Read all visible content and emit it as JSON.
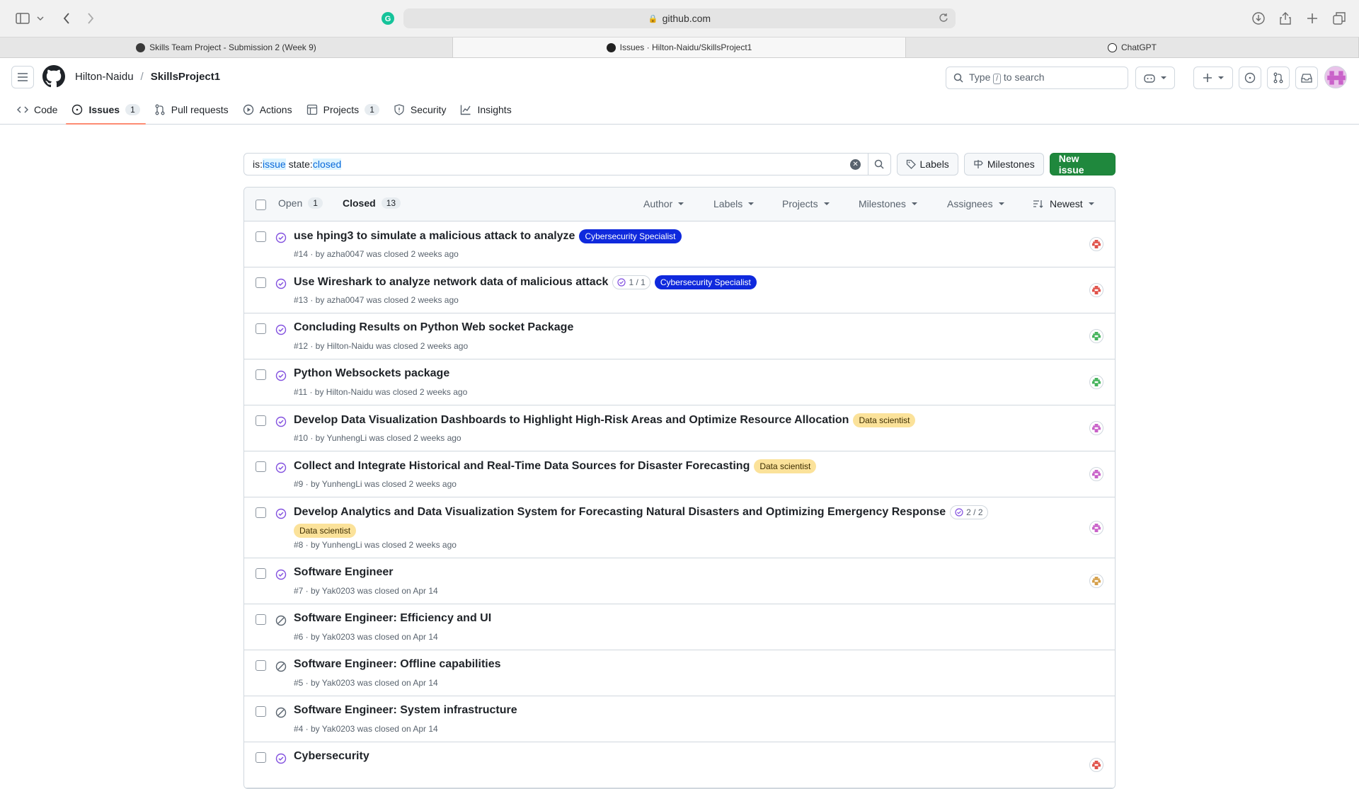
{
  "browser": {
    "address": "github.com",
    "tabs": [
      {
        "label": "Skills Team Project - Submission 2 (Week 9)",
        "active": false
      },
      {
        "label": "Issues · Hilton-Naidu/SkillsProject1",
        "active": true
      },
      {
        "label": "ChatGPT",
        "active": false
      }
    ]
  },
  "header": {
    "owner": "Hilton-Naidu",
    "separator": "/",
    "repo": "SkillsProject1",
    "search_prefix": "Type",
    "search_key": "/",
    "search_suffix": "to search"
  },
  "repo_nav": [
    {
      "label": "Code",
      "count": null,
      "icon": "code-icon"
    },
    {
      "label": "Issues",
      "count": "1",
      "icon": "issue-icon",
      "active": true
    },
    {
      "label": "Pull requests",
      "count": null,
      "icon": "pull-request-icon"
    },
    {
      "label": "Actions",
      "count": null,
      "icon": "play-icon"
    },
    {
      "label": "Projects",
      "count": "1",
      "icon": "table-icon"
    },
    {
      "label": "Security",
      "count": null,
      "icon": "shield-icon"
    },
    {
      "label": "Insights",
      "count": null,
      "icon": "graph-icon"
    }
  ],
  "filter": {
    "q1": "is:",
    "q2": "issue",
    "q3": " state:",
    "q4": "closed",
    "labels_btn": "Labels",
    "milestones_btn": "Milestones",
    "new_issue_btn": "New issue"
  },
  "list_header": {
    "open_label": "Open",
    "open_count": "1",
    "closed_label": "Closed",
    "closed_count": "13",
    "author": "Author",
    "labels": "Labels",
    "projects": "Projects",
    "milestones": "Milestones",
    "assignees": "Assignees",
    "sort": "Newest"
  },
  "issues": [
    {
      "title": "use hping3 to simulate a malicious attack to analyze",
      "label": "Cybersecurity Specialist",
      "label_type": "cyber",
      "tasks": "",
      "meta": "#14 · by azha0047 was closed 2 weeks ago",
      "state": "completed",
      "avatar_color": "#e0524a"
    },
    {
      "title": "Use Wireshark to analyze network data of malicious attack",
      "label": "Cybersecurity Specialist",
      "label_type": "cyber",
      "tasks": "1 / 1",
      "meta": "#13 · by azha0047 was closed 2 weeks ago",
      "state": "completed",
      "avatar_color": "#e0524a"
    },
    {
      "title": "Concluding Results on Python Web socket Package",
      "label": "",
      "label_type": "",
      "tasks": "",
      "meta": "#12 · by Hilton-Naidu was closed 2 weeks ago",
      "state": "completed",
      "avatar_color": "#45b35c"
    },
    {
      "title": "Python Websockets package",
      "label": "",
      "label_type": "",
      "tasks": "",
      "meta": "#11 · by Hilton-Naidu was closed 2 weeks ago",
      "state": "completed",
      "avatar_color": "#45b35c"
    },
    {
      "title": "Develop Data Visualization Dashboards to Highlight High-Risk Areas and Optimize Resource Allocation",
      "label": "Data scientist",
      "label_type": "data",
      "tasks": "",
      "meta": "#10 · by YunhengLi was closed 2 weeks ago",
      "state": "completed",
      "avatar_color": "#c962c9"
    },
    {
      "title": "Collect and Integrate Historical and Real-Time Data Sources for Disaster Forecasting",
      "label": "Data scientist",
      "label_type": "data",
      "tasks": "",
      "meta": "#9 · by YunhengLi was closed 2 weeks ago",
      "state": "completed",
      "avatar_color": "#c962c9"
    },
    {
      "title": "Develop Analytics and Data Visualization System for Forecasting Natural Disasters and Optimizing Emergency Response",
      "label": "Data scientist",
      "label_type": "data",
      "tasks": "2 / 2",
      "meta": "#8 · by YunhengLi was closed 2 weeks ago",
      "state": "completed",
      "avatar_color": "#c962c9",
      "tall": true
    },
    {
      "title": "Software Engineer",
      "label": "",
      "label_type": "",
      "tasks": "",
      "meta": "#7 · by Yak0203 was closed on Apr 14",
      "state": "completed",
      "avatar_color": "#d5a04b"
    },
    {
      "title": "Software Engineer: Efficiency and UI",
      "label": "",
      "label_type": "",
      "tasks": "",
      "meta": "#6 · by Yak0203 was closed on Apr 14",
      "state": "not_planned",
      "avatar_color": ""
    },
    {
      "title": "Software Engineer: Offline capabilities",
      "label": "",
      "label_type": "",
      "tasks": "",
      "meta": "#5 · by Yak0203 was closed on Apr 14",
      "state": "not_planned",
      "avatar_color": ""
    },
    {
      "title": "Software Engineer: System infrastructure",
      "label": "",
      "label_type": "",
      "tasks": "",
      "meta": "#4 · by Yak0203 was closed on Apr 14",
      "state": "not_planned",
      "avatar_color": ""
    },
    {
      "title": "Cybersecurity",
      "label": "",
      "label_type": "",
      "tasks": "",
      "meta": "",
      "state": "completed",
      "avatar_color": "#e0524a"
    }
  ],
  "colors": {
    "completed": "#8250df",
    "not_planned": "#59636e",
    "primary": "#1f883d",
    "accent_underline": "#fd8c73"
  }
}
